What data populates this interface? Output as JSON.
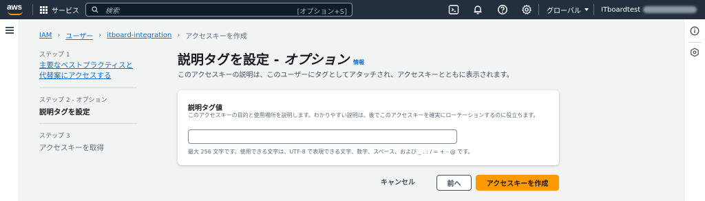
{
  "topnav": {
    "logo_text": "aws",
    "services_label": "サービス",
    "search_placeholder": "検索",
    "search_shortcut": "[オプション+S]",
    "icons": [
      "cloudshell-icon",
      "bell-icon",
      "help-icon",
      "gear-icon"
    ],
    "region_label": "グローバル",
    "account_label": "ITboardtest"
  },
  "colors": {
    "nav_bg": "#232f3e",
    "accent_orange": "#ff9900",
    "link_blue": "#0972d3",
    "page_bg": "#f2f3f3"
  },
  "breadcrumb": {
    "items": [
      "IAM",
      "ユーザー",
      "itboard-integration",
      "アクセスキーを作成"
    ]
  },
  "steps": [
    {
      "label": "ステップ 1",
      "title": "主要なベストプラクティスと代替案にアクセスする",
      "state": "link"
    },
    {
      "label": "ステップ 2 - オプション",
      "title": "説明タグを設定",
      "state": "current"
    },
    {
      "label": "ステップ 3",
      "title": "アクセスキーを取得",
      "state": "disabled"
    }
  ],
  "main": {
    "title": "説明タグを設定 - ",
    "title_italic": "オプション",
    "info_link": "情報",
    "subtitle": "このアクセスキーの説明は、このユーザーにタグとしてアタッチされ、アクセスキーとともに表示されます。"
  },
  "form": {
    "field_label": "説明タグ値",
    "field_description": "このアクセスキーの目的と使用場所を説明します。わかりやすい説明は、後でこのアクセスキーを確実にローテーションするのに役立ちます。",
    "field_value": "",
    "field_hint": "最大 256 文字です。使用できる文字は、UTF-8 で表現できる文字、数字、スペース、および _ . : / = + - @ です。"
  },
  "buttons": {
    "cancel": "キャンセル",
    "previous": "前へ",
    "create": "アクセスキーを作成"
  }
}
